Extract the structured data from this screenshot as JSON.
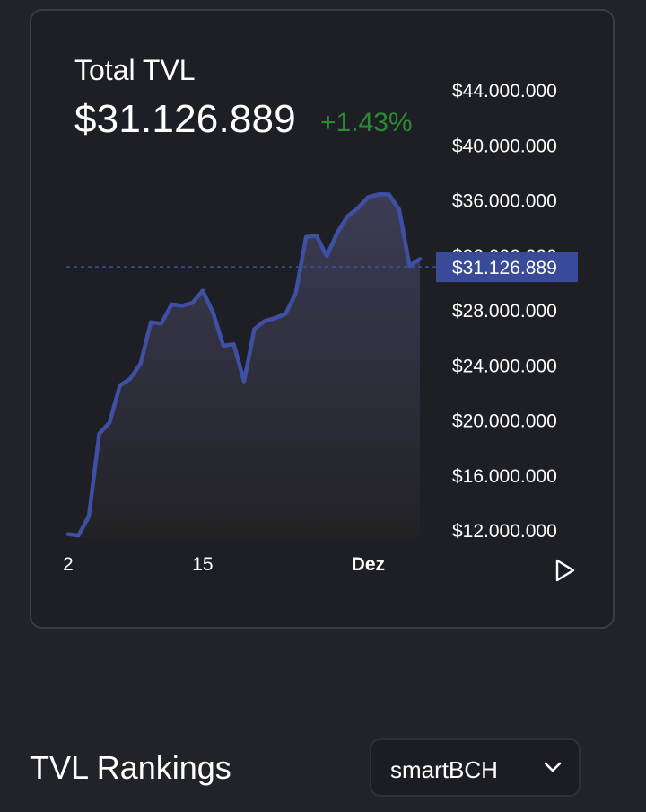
{
  "header": {
    "title": "Total TVL",
    "value": "$31.126.889",
    "change": "+1.43%"
  },
  "chart_data": {
    "type": "area",
    "title": "Total TVL",
    "y_axis_side": "right",
    "ylim": [
      10000000,
      46000000
    ],
    "y_ticks": [
      44000000,
      40000000,
      36000000,
      32000000,
      28000000,
      24000000,
      20000000,
      16000000,
      12000000
    ],
    "y_tick_labels": [
      "$44.000.000",
      "$40.000.000",
      "$36.000.000",
      "$32.000.000",
      "$28.000.000",
      "$24.000.000",
      "$20.000.000",
      "$16.000.000",
      "$12.000.000"
    ],
    "x_tick_labels": [
      "2",
      "15",
      "Dez"
    ],
    "x_tick_index": [
      0,
      13,
      29
    ],
    "current_value": 31126889,
    "current_label": "$31.126.889",
    "series": [
      {
        "values": [
          11700000,
          11600000,
          13000000,
          19000000,
          19800000,
          22500000,
          23000000,
          24100000,
          27100000,
          27000000,
          28400000,
          28300000,
          28500000,
          29400000,
          27800000,
          25400000,
          25500000,
          22800000,
          26600000,
          27200000,
          27400000,
          27700000,
          29200000,
          33300000,
          33400000,
          31900000,
          33600000,
          34800000,
          35400000,
          36200000,
          36400000,
          36400000,
          35300000,
          31200000,
          31700000
        ]
      }
    ],
    "colors": {
      "line": "#3f4fa3",
      "fill_top": "#3c3c55",
      "fill_bottom": "#222226",
      "price_tag": "#394a99"
    },
    "grid": false
  },
  "rankings": {
    "title": "TVL Rankings",
    "selected_chain": "smartBCH"
  },
  "icons": {
    "play": "play-icon",
    "chevron": "chevron-down-icon"
  }
}
